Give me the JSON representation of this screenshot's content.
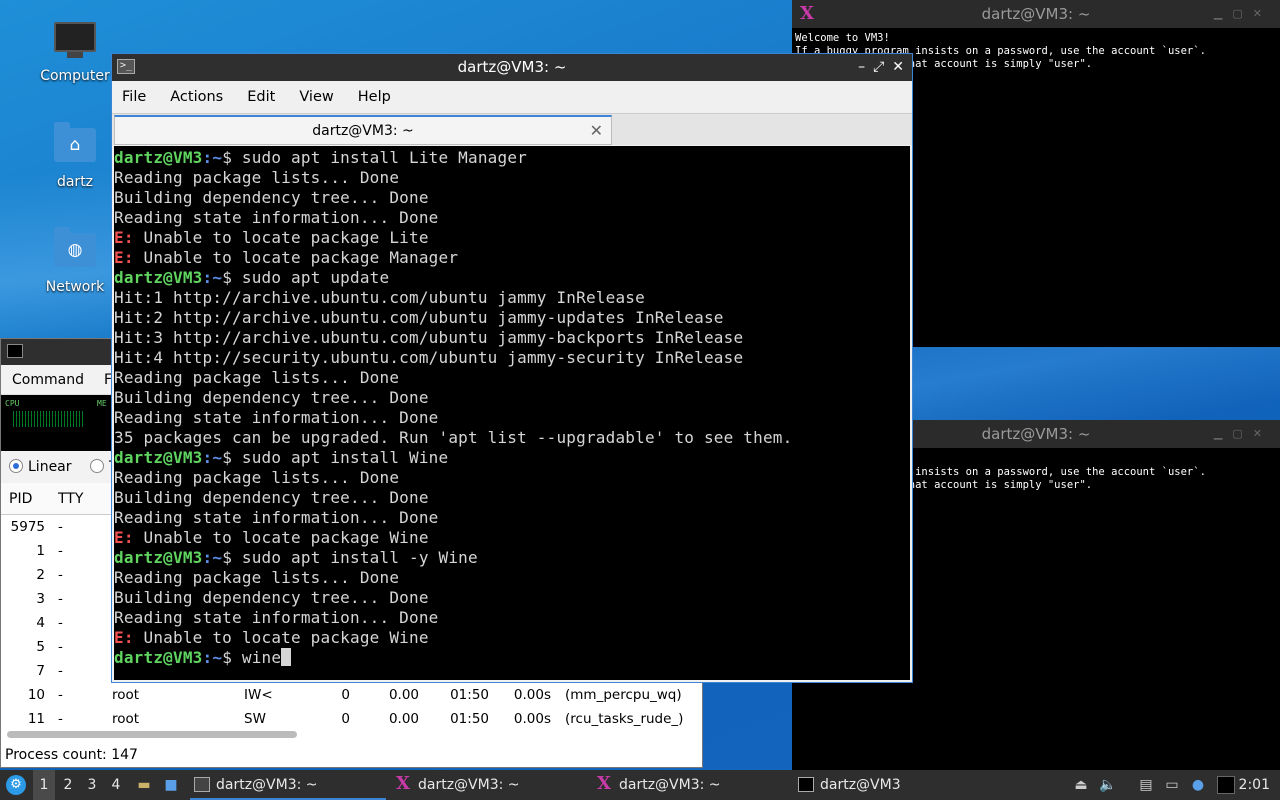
{
  "desktop": {
    "icons": [
      {
        "label": "Computer",
        "icon": "computer-icon"
      },
      {
        "label": "dartz",
        "icon": "home-folder-icon"
      },
      {
        "label": "Network",
        "icon": "network-folder-icon"
      }
    ]
  },
  "xterm_top": {
    "title": "dartz@VM3: ~",
    "lines": [
      "Welcome to VM3!",
      "If a buggy program insists on a password, use the account `user`.",
      "The password for that account is simply \"user\"."
    ]
  },
  "xterm_bottom": {
    "title": "dartz@VM3: ~",
    "lines": [
      "If a buggy program insists on a password, use the account `user`.",
      "The password for that account is simply \"user\"."
    ]
  },
  "task_manager": {
    "menu": [
      "Command",
      "F"
    ],
    "graph_labels": {
      "cpu": "CPU",
      "mem": "ME"
    },
    "scale_linear": "Linear",
    "scale_other": "T",
    "columns": [
      "PID",
      "TTY"
    ],
    "rows": [
      {
        "pid": "5975",
        "tty": "-",
        "user": "",
        "state": "",
        "nice": "",
        "cpu": "",
        "time": "",
        "cpu_time": "",
        "cmd": ""
      },
      {
        "pid": "1",
        "tty": "-",
        "user": "",
        "state": "",
        "nice": "",
        "cpu": "",
        "time": "",
        "cpu_time": "",
        "cmd": ""
      },
      {
        "pid": "2",
        "tty": "-",
        "user": "",
        "state": "",
        "nice": "",
        "cpu": "",
        "time": "",
        "cpu_time": "",
        "cmd": ""
      },
      {
        "pid": "3",
        "tty": "-",
        "user": "",
        "state": "",
        "nice": "",
        "cpu": "",
        "time": "",
        "cpu_time": "",
        "cmd": ""
      },
      {
        "pid": "4",
        "tty": "-",
        "user": "",
        "state": "",
        "nice": "",
        "cpu": "",
        "time": "",
        "cpu_time": "",
        "cmd": ""
      },
      {
        "pid": "5",
        "tty": "-",
        "user": "",
        "state": "",
        "nice": "",
        "cpu": "",
        "time": "",
        "cpu_time": "",
        "cmd": ""
      },
      {
        "pid": "7",
        "tty": "-",
        "user": "",
        "state": "",
        "nice": "",
        "cpu": "",
        "time": "",
        "cpu_time": "",
        "cmd": ""
      },
      {
        "pid": "10",
        "tty": "-",
        "user": "root",
        "state": "IW<",
        "nice": "0",
        "cpu": "0.00",
        "time": "01:50",
        "cpu_time": "0.00s",
        "cmd": "(mm_percpu_wq)"
      },
      {
        "pid": "11",
        "tty": "-",
        "user": "root",
        "state": "SW",
        "nice": "0",
        "cpu": "0.00",
        "time": "01:50",
        "cpu_time": "0.00s",
        "cmd": "(rcu_tasks_rude_)"
      }
    ],
    "status": "Process count: 147"
  },
  "terminal": {
    "window_title": "dartz@VM3: ~",
    "menu": [
      "File",
      "Actions",
      "Edit",
      "View",
      "Help"
    ],
    "tab_title": "dartz@VM3: ~",
    "prompt_user": "dartz@VM3",
    "prompt_path": "~",
    "lines": [
      {
        "type": "cmd",
        "text": "sudo apt install Lite Manager"
      },
      {
        "type": "out",
        "text": "Reading package lists... Done"
      },
      {
        "type": "out",
        "text": "Building dependency tree... Done"
      },
      {
        "type": "out",
        "text": "Reading state information... Done"
      },
      {
        "type": "err",
        "text": "Unable to locate package Lite"
      },
      {
        "type": "err",
        "text": "Unable to locate package Manager"
      },
      {
        "type": "cmd",
        "text": "sudo apt update"
      },
      {
        "type": "out",
        "text": "Hit:1 http://archive.ubuntu.com/ubuntu jammy InRelease"
      },
      {
        "type": "out",
        "text": "Hit:2 http://archive.ubuntu.com/ubuntu jammy-updates InRelease"
      },
      {
        "type": "out",
        "text": "Hit:3 http://archive.ubuntu.com/ubuntu jammy-backports InRelease"
      },
      {
        "type": "out",
        "text": "Hit:4 http://security.ubuntu.com/ubuntu jammy-security InRelease"
      },
      {
        "type": "out",
        "text": "Reading package lists... Done"
      },
      {
        "type": "out",
        "text": "Building dependency tree... Done"
      },
      {
        "type": "out",
        "text": "Reading state information... Done"
      },
      {
        "type": "out",
        "text": "35 packages can be upgraded. Run 'apt list --upgradable' to see them."
      },
      {
        "type": "cmd",
        "text": "sudo apt install Wine"
      },
      {
        "type": "out",
        "text": "Reading package lists... Done"
      },
      {
        "type": "out",
        "text": "Building dependency tree... Done"
      },
      {
        "type": "out",
        "text": "Reading state information... Done"
      },
      {
        "type": "err",
        "text": "Unable to locate package Wine"
      },
      {
        "type": "cmd",
        "text": "sudo apt install -y Wine"
      },
      {
        "type": "out",
        "text": "Reading package lists... Done"
      },
      {
        "type": "out",
        "text": "Building dependency tree... Done"
      },
      {
        "type": "out",
        "text": "Reading state information... Done"
      },
      {
        "type": "err",
        "text": "Unable to locate package Wine"
      },
      {
        "type": "input",
        "text": "wine"
      }
    ],
    "error_prefix": "E:"
  },
  "taskbar": {
    "workspaces": [
      "1",
      "2",
      "3",
      "4"
    ],
    "tasks": [
      {
        "label": "dartz@VM3: ~",
        "icon": "terminal-icon"
      },
      {
        "label": "dartz@VM3: ~",
        "icon": "xterm-icon"
      },
      {
        "label": "dartz@VM3: ~",
        "icon": "xterm-icon"
      },
      {
        "label": "dartz@VM3",
        "icon": "terminal-icon"
      }
    ],
    "clock": "2:01"
  }
}
